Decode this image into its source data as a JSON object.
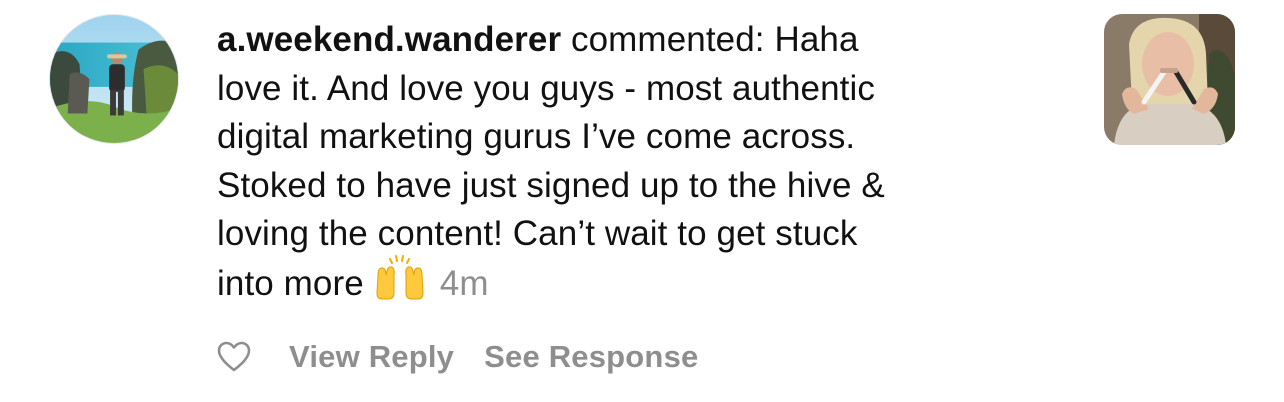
{
  "notification": {
    "username": "a.weekend.wanderer",
    "action_text": "commented:",
    "comment_line_1": "Haha",
    "comment_line_2": "love it. And love you guys - most authentic",
    "comment_line_3": "digital marketing gurus I’ve come across.",
    "comment_line_4": "Stoked to have just signed up to the hive &",
    "comment_line_5": "loving the content! Can’t wait to get stuck",
    "comment_line_6": "into more",
    "emoji": "raising-hands-emoji",
    "timestamp": "4m"
  },
  "actions": {
    "like_icon": "heart-outline-icon",
    "view_reply_label": "View Reply",
    "see_response_label": "See Response"
  },
  "colors": {
    "text": "#111111",
    "secondary_text": "#8e8e8e"
  }
}
